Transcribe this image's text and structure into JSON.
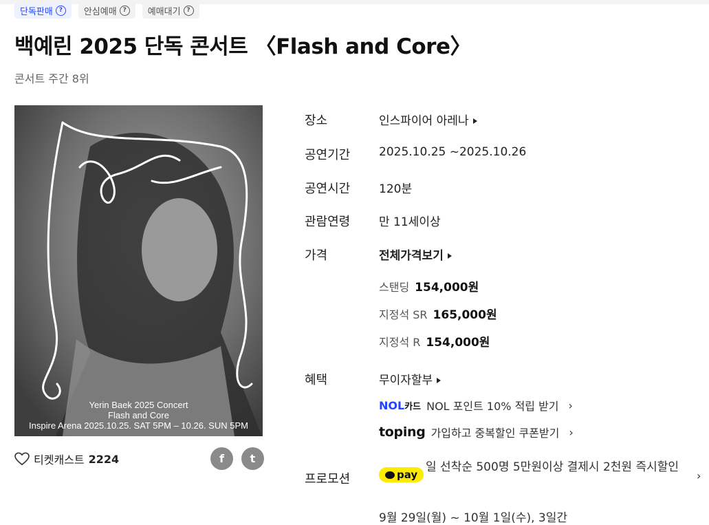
{
  "badges": [
    {
      "label": "단독판매",
      "style": "blue"
    },
    {
      "label": "안심예매",
      "style": "gray"
    },
    {
      "label": "예매대기",
      "style": "gray"
    }
  ],
  "title": "백예린 2025 단독 콘서트 〈Flash and Core〉",
  "rank": "콘서트 주간 8위",
  "poster": {
    "line1": "Yerin Baek 2025 Concert",
    "line2": "Flash and Core",
    "line3": "Inspire Arena 2025.10.25. SAT 5PM – 10.26. SUN 5PM"
  },
  "favorite": {
    "label": "티켓캐스트",
    "count": "2224"
  },
  "share": {
    "facebook": "f",
    "twitter": "t"
  },
  "info": {
    "venue": {
      "label": "장소",
      "value": "인스파이어 아레나"
    },
    "period": {
      "label": "공연기간",
      "value": "2025.10.25  ~2025.10.26"
    },
    "runtime": {
      "label": "공연시간",
      "value": "120분"
    },
    "age": {
      "label": "관람연령",
      "value": "만 11세이상"
    },
    "price": {
      "label": "가격",
      "all_label": "전체가격보기",
      "items": [
        {
          "name": "스탠딩",
          "amount": "154,000원"
        },
        {
          "name": "지정석 SR",
          "amount": "165,000원"
        },
        {
          "name": "지정석 R",
          "amount": "154,000원"
        }
      ]
    },
    "benefit": {
      "label": "혜택",
      "value": "무이자할부",
      "nol_logo": "NOL",
      "nol_card": "카드",
      "nol_text": "NOL 포인트 10% 적립 받기",
      "toping_logo": "toping",
      "toping_text": "가입하고 중복할인 쿠폰받기"
    },
    "promotion": {
      "label": "프로모션",
      "pay_logo": "pay",
      "text": "일 선착순 500명 5만원이상 결제시 2천원 즉시할인",
      "next_line": "9월 29일(월) ~ 10월 1일(수), 3일간"
    }
  },
  "colors": {
    "accent_blue": "#2548ff",
    "kakao_yellow": "#ffeb00"
  }
}
